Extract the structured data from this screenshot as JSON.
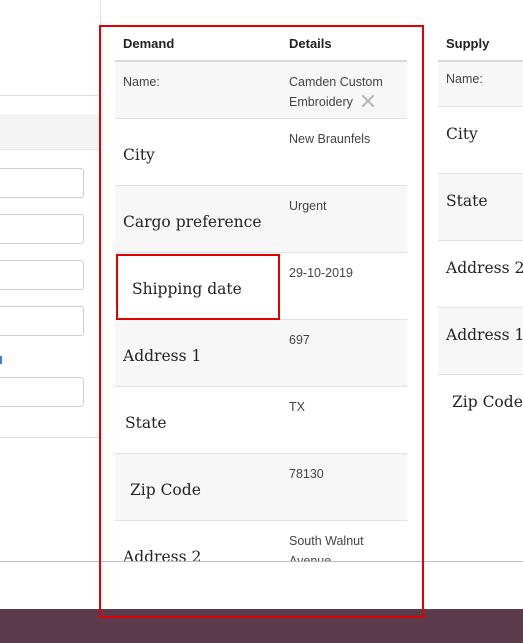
{
  "demand": {
    "header": {
      "col1": "Demand",
      "col2": "Details"
    },
    "rows": [
      {
        "label": "Name:",
        "value": "Camden Custom Embroidery"
      },
      {
        "label": "City",
        "value": "New Braunfels"
      },
      {
        "label": "Cargo preference",
        "value": "Urgent"
      },
      {
        "label": "Shipping date",
        "value": "29-10-2019"
      },
      {
        "label": "Address 1",
        "value": "697"
      },
      {
        "label": "State",
        "value": "TX"
      },
      {
        "label": "Zip Code",
        "value": "78130"
      },
      {
        "label": "Address 2",
        "value": "South Walnut Avenue"
      }
    ]
  },
  "supply": {
    "header": "Supply",
    "rows": [
      "Name:",
      "City",
      "State",
      "Address 2",
      "Address 1",
      "Zip Code"
    ]
  },
  "colors": {
    "highlight": "#e30000",
    "footer": "#5c3b4c"
  }
}
